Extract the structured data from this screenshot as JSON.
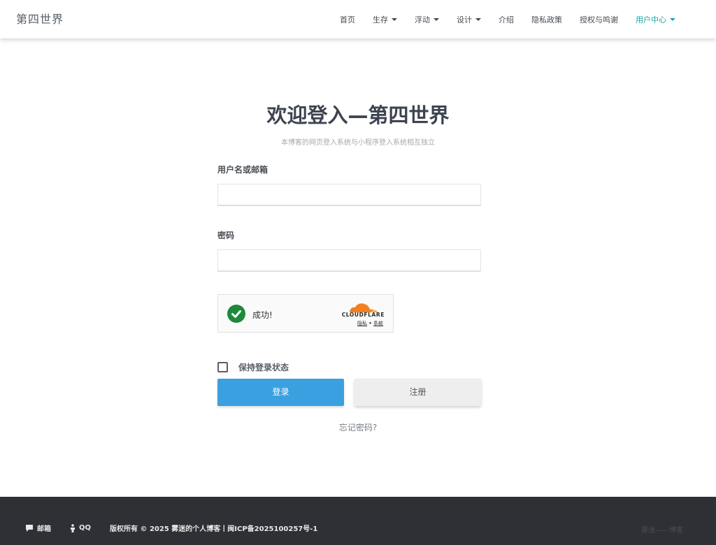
{
  "header": {
    "brand": "第四世界",
    "nav": [
      {
        "label": "首页",
        "dropdown": false,
        "active": false
      },
      {
        "label": "生存",
        "dropdown": true,
        "active": false
      },
      {
        "label": "浮动",
        "dropdown": true,
        "active": false
      },
      {
        "label": "设计",
        "dropdown": true,
        "active": false
      },
      {
        "label": "介绍",
        "dropdown": false,
        "active": false
      },
      {
        "label": "隐私政策",
        "dropdown": false,
        "active": false
      },
      {
        "label": "授权与鸣谢",
        "dropdown": false,
        "active": false
      },
      {
        "label": "用户中心",
        "dropdown": true,
        "active": true
      }
    ]
  },
  "login": {
    "title": "欢迎登入—第四世界",
    "subtitle": "本博客的网页登入系统与小程序登入系统相互独立",
    "username_label": "用户名或邮箱",
    "username_value": "",
    "password_label": "密码",
    "password_value": "",
    "remember_label": "保持登录状态",
    "remember_checked": false,
    "login_button": "登录",
    "register_button": "注册",
    "forgot_link": "忘记密码?"
  },
  "captcha": {
    "status": "成功!",
    "brand": "CLOUDFLARE",
    "privacy_link": "隐私",
    "separator": "•",
    "terms_link": "条款"
  },
  "footer": {
    "mail_label": "邮箱",
    "qq_label": "QQ",
    "copyright": "版权所有 © 2025 雾迷的个人博客丨闽ICP备2025100257号-1",
    "right_text": "雾迷——博客"
  },
  "colors": {
    "accent": "#1aa6a6",
    "login_button": "#3aa0e0",
    "register_button": "#eeeeee",
    "success": "#1c8a3a",
    "cloudflare_orange": "#f38020",
    "footer_bg": "#2e3035"
  }
}
